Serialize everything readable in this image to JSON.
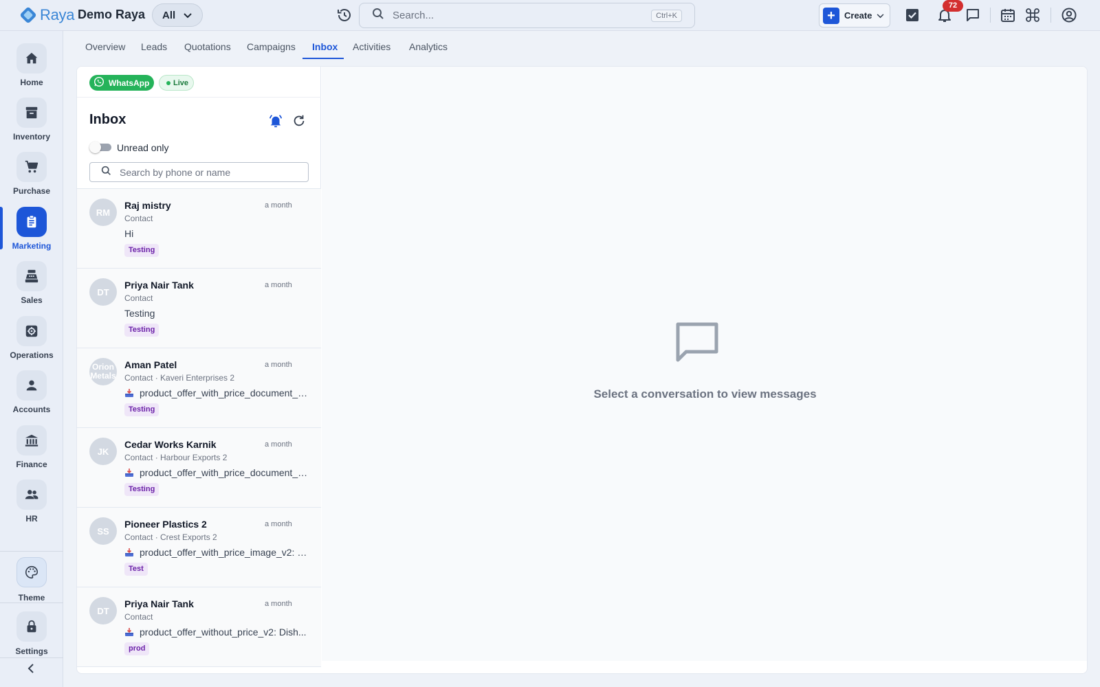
{
  "app": {
    "logo_text": "Raya",
    "company": "Demo Raya",
    "scope": "All"
  },
  "search": {
    "placeholder": "Search...",
    "shortcut": "Ctrl+K"
  },
  "toolbar": {
    "create_label": "Create",
    "notifications_count": "72"
  },
  "sidebar": {
    "items": [
      {
        "label": "Home",
        "icon": "home-icon"
      },
      {
        "label": "Inventory",
        "icon": "archive-icon"
      },
      {
        "label": "Purchase",
        "icon": "cart-icon"
      },
      {
        "label": "Marketing",
        "icon": "clipboard-icon",
        "active": true
      },
      {
        "label": "Sales",
        "icon": "cash-register-icon"
      },
      {
        "label": "Operations",
        "icon": "settings-box-icon"
      },
      {
        "label": "Accounts",
        "icon": "person-icon"
      },
      {
        "label": "Finance",
        "icon": "bank-icon"
      },
      {
        "label": "HR",
        "icon": "people-icon"
      }
    ],
    "theme_label": "Theme",
    "settings_label": "Settings"
  },
  "tabs": [
    {
      "label": "Overview"
    },
    {
      "label": "Leads"
    },
    {
      "label": "Quotations"
    },
    {
      "label": "Campaigns"
    },
    {
      "label": "Inbox",
      "active": true
    },
    {
      "label": "Activities"
    },
    {
      "label": "Analytics"
    }
  ],
  "inbox": {
    "channel": "WhatsApp",
    "status": "Live",
    "title": "Inbox",
    "unread_only_label": "Unread only",
    "unread_only": false,
    "search_placeholder": "Search by phone or name",
    "conversations": [
      {
        "initials": "RM",
        "name": "Raj mistry",
        "time": "a month",
        "subtitle": "Contact",
        "message": "Hi",
        "has_attachment": false,
        "tag": "Testing"
      },
      {
        "initials": "DT",
        "name": "Priya Nair Tank",
        "time": "a month",
        "subtitle": "Contact",
        "message": "Testing",
        "has_attachment": false,
        "tag": "Testing"
      },
      {
        "initials": "Orion Metals",
        "name": "Aman Patel",
        "time": "a month",
        "subtitle": "Contact · Kaveri Enterprises 2",
        "message": "product_offer_with_price_document_v2...",
        "has_attachment": true,
        "tag": "Testing"
      },
      {
        "initials": "JK",
        "name": "Cedar Works Karnik",
        "time": "a month",
        "subtitle": "Contact · Harbour Exports 2",
        "message": "product_offer_with_price_document_v2...",
        "has_attachment": true,
        "tag": "Testing"
      },
      {
        "initials": "SS",
        "name": "Pioneer Plastics 2",
        "time": "a month",
        "subtitle": "Contact · Crest Exports 2",
        "message": "product_offer_with_price_image_v2: S...",
        "has_attachment": true,
        "tag": "Test"
      },
      {
        "initials": "DT",
        "name": "Priya Nair Tank",
        "time": "a month",
        "subtitle": "Contact",
        "message": "product_offer_without_price_v2: Dish...",
        "has_attachment": true,
        "tag": "prod"
      }
    ],
    "empty_state_text": "Select a conversation to view messages"
  },
  "colors": {
    "accent": "#1d56d8",
    "whatsapp": "#25b35a",
    "badge": "#d32f2f",
    "tag_bg": "#efe6f8",
    "tag_text": "#6b21a8"
  }
}
